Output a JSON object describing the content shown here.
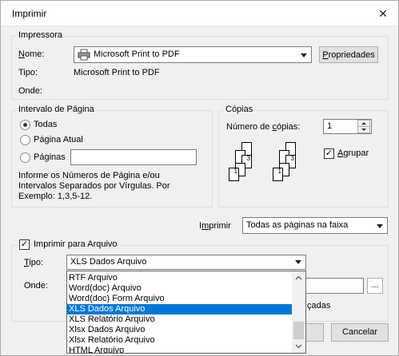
{
  "window": {
    "title": "Imprimir",
    "close_label": "✕"
  },
  "printer_group": {
    "label": "Impressora",
    "name_label": "Nome:",
    "name_value": "Microsoft Print to PDF",
    "properties_label": "Propriedades",
    "type_label": "Tipo:",
    "type_value": "Microsoft Print to PDF",
    "where_label": "Onde:"
  },
  "range_group": {
    "label": "Intervalo de Página",
    "all_label": "Todas",
    "current_label": "Página Atual",
    "pages_label": "Páginas",
    "pages_value": "",
    "help_text_1": "Informe os Números de Página e/ou",
    "help_text_2": "Intervalos Separados por Vírgulas. Por",
    "help_text_3": "Exemplo: 1,3,5-12."
  },
  "copies_group": {
    "label": "Cópias",
    "count_label": "Número de cópias:",
    "count_value": "1",
    "collate_label": "Agrupar",
    "collate_checked": true
  },
  "print_what": {
    "label": "Imprimir",
    "value": "Todas as páginas na faixa"
  },
  "file_group": {
    "label": "Imprimir para Arquivo",
    "checked": true,
    "type_label": "Tipo:",
    "type_value": "XLS Dados Arquivo",
    "where_label": "Onde:",
    "browse_label": "...",
    "partial_text": "çadas"
  },
  "dropdown": {
    "items": [
      "RTF Arquivo",
      "Word(doc) Arquivo",
      "Word(doc) Form Arquivo",
      "XLS Dados Arquivo",
      "XLS Relatório Arquivo",
      "Xlsx Dados Arquivo",
      "Xlsx Relatório Arquivo",
      "HTML Arquivo"
    ],
    "selected_index": 3
  },
  "buttons": {
    "cancel_label": "Cancelar"
  },
  "colors": {
    "selection": "#0078d7",
    "dialog_bg": "#f0f0f0"
  }
}
